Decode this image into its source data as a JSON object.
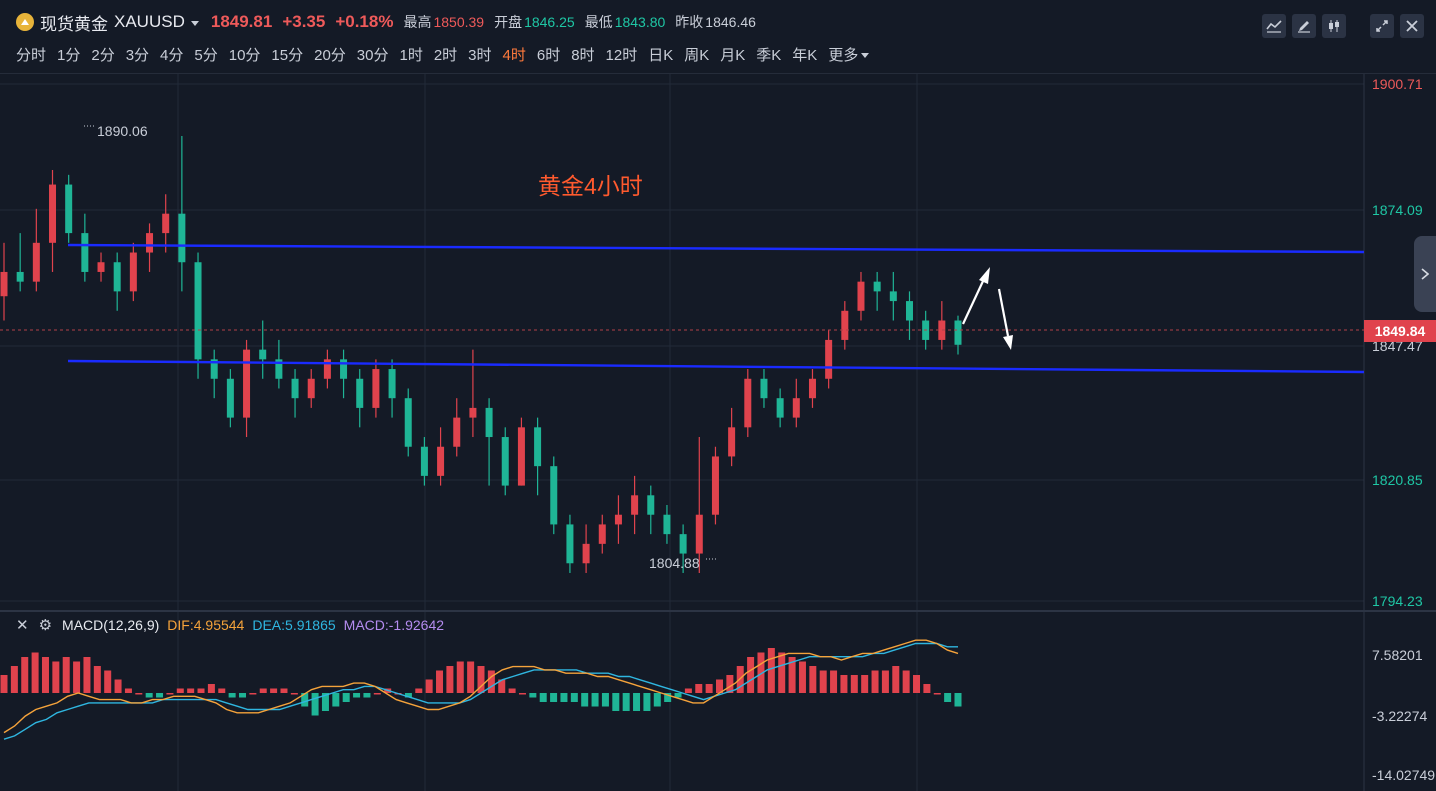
{
  "header": {
    "symbol_name": "现货黄金",
    "symbol_code": "XAUUSD",
    "last_price": "1849.81",
    "change": "+3.35",
    "change_pct": "+0.18%",
    "high_label": "最高",
    "high_value": "1850.39",
    "open_label": "开盘",
    "open_value": "1846.25",
    "low_label": "最低",
    "low_value": "1843.80",
    "prev_label": "昨收",
    "prev_value": "1846.46",
    "tools": [
      "indicator-icon",
      "draw-icon",
      "candle-type-icon",
      "fullscreen-icon",
      "close-icon"
    ]
  },
  "periods": [
    {
      "label": "分时"
    },
    {
      "label": "1分"
    },
    {
      "label": "2分"
    },
    {
      "label": "3分"
    },
    {
      "label": "4分"
    },
    {
      "label": "5分"
    },
    {
      "label": "10分"
    },
    {
      "label": "15分"
    },
    {
      "label": "20分"
    },
    {
      "label": "30分"
    },
    {
      "label": "1时"
    },
    {
      "label": "2时"
    },
    {
      "label": "3时"
    },
    {
      "label": "4时",
      "active": true
    },
    {
      "label": "6时"
    },
    {
      "label": "8时"
    },
    {
      "label": "12时"
    },
    {
      "label": "日K"
    },
    {
      "label": "周K"
    },
    {
      "label": "月K"
    },
    {
      "label": "季K"
    },
    {
      "label": "年K"
    },
    {
      "label": "更多"
    }
  ],
  "chart": {
    "annotation": "黄金4小时",
    "max_label": "1890.06",
    "min_label": "1804.88",
    "current_price_tag": "1849.84",
    "axis_labels": [
      "1900.71",
      "1874.09",
      "1847.47",
      "1820.85",
      "1794.23"
    ],
    "colors": {
      "up": "#e0434d",
      "down": "#1fb596",
      "trendline": "#1a2bff",
      "arrow": "#ffffff"
    }
  },
  "macd": {
    "title": "MACD(12,26,9)",
    "dif": "DIF:4.95544",
    "dea": "DEA:5.91865",
    "macd": "MACD:-1.92642",
    "axis_labels": [
      "7.58201",
      "-3.22274",
      "-14.02749"
    ]
  },
  "chart_data": {
    "type": "candlestick",
    "ylim": [
      1794.23,
      1900.71
    ],
    "candles": [
      [
        1857,
        1862,
        1852,
        1868
      ],
      [
        1862,
        1860,
        1858,
        1870
      ],
      [
        1860,
        1868,
        1858,
        1875
      ],
      [
        1868,
        1880,
        1862,
        1883
      ],
      [
        1880,
        1870,
        1868,
        1882
      ],
      [
        1870,
        1862,
        1860,
        1874
      ],
      [
        1862,
        1864,
        1860,
        1866
      ],
      [
        1864,
        1858,
        1854,
        1866
      ],
      [
        1858,
        1866,
        1856,
        1868
      ],
      [
        1866,
        1870,
        1862,
        1872
      ],
      [
        1870,
        1874,
        1866,
        1878
      ],
      [
        1874,
        1864,
        1858,
        1890
      ],
      [
        1864,
        1844,
        1840,
        1866
      ],
      [
        1844,
        1840,
        1836,
        1846
      ],
      [
        1840,
        1832,
        1830,
        1842
      ],
      [
        1832,
        1846,
        1828,
        1848
      ],
      [
        1846,
        1844,
        1840,
        1852
      ],
      [
        1844,
        1840,
        1838,
        1848
      ],
      [
        1840,
        1836,
        1832,
        1842
      ],
      [
        1836,
        1840,
        1834,
        1842
      ],
      [
        1840,
        1844,
        1838,
        1846
      ],
      [
        1844,
        1840,
        1836,
        1846
      ],
      [
        1840,
        1834,
        1830,
        1842
      ],
      [
        1834,
        1842,
        1832,
        1844
      ],
      [
        1842,
        1836,
        1832,
        1844
      ],
      [
        1836,
        1826,
        1824,
        1838
      ],
      [
        1826,
        1820,
        1818,
        1828
      ],
      [
        1820,
        1826,
        1818,
        1830
      ],
      [
        1826,
        1832,
        1824,
        1836
      ],
      [
        1832,
        1834,
        1828,
        1846
      ],
      [
        1834,
        1828,
        1818,
        1836
      ],
      [
        1828,
        1818,
        1816,
        1830
      ],
      [
        1818,
        1830,
        1818,
        1832
      ],
      [
        1830,
        1822,
        1816,
        1832
      ],
      [
        1822,
        1810,
        1808,
        1824
      ],
      [
        1810,
        1802,
        1800,
        1812
      ],
      [
        1802,
        1806,
        1800,
        1810
      ],
      [
        1806,
        1810,
        1804,
        1812
      ],
      [
        1810,
        1812,
        1806,
        1816
      ],
      [
        1812,
        1816,
        1808,
        1820
      ],
      [
        1816,
        1812,
        1808,
        1818
      ],
      [
        1812,
        1808,
        1806,
        1814
      ],
      [
        1808,
        1804,
        1800,
        1810
      ],
      [
        1804,
        1812,
        1800,
        1828
      ],
      [
        1812,
        1824,
        1810,
        1826
      ],
      [
        1824,
        1830,
        1822,
        1834
      ],
      [
        1830,
        1840,
        1828,
        1842
      ],
      [
        1840,
        1836,
        1834,
        1842
      ],
      [
        1836,
        1832,
        1830,
        1838
      ],
      [
        1832,
        1836,
        1830,
        1840
      ],
      [
        1836,
        1840,
        1834,
        1842
      ],
      [
        1840,
        1848,
        1838,
        1850
      ],
      [
        1848,
        1854,
        1846,
        1856
      ],
      [
        1854,
        1860,
        1852,
        1862
      ],
      [
        1860,
        1858,
        1854,
        1862
      ],
      [
        1858,
        1856,
        1852,
        1862
      ],
      [
        1856,
        1852,
        1848,
        1858
      ],
      [
        1852,
        1848,
        1846,
        1854
      ],
      [
        1848,
        1852,
        1846,
        1856
      ],
      [
        1852,
        1847,
        1845,
        1853
      ]
    ]
  }
}
